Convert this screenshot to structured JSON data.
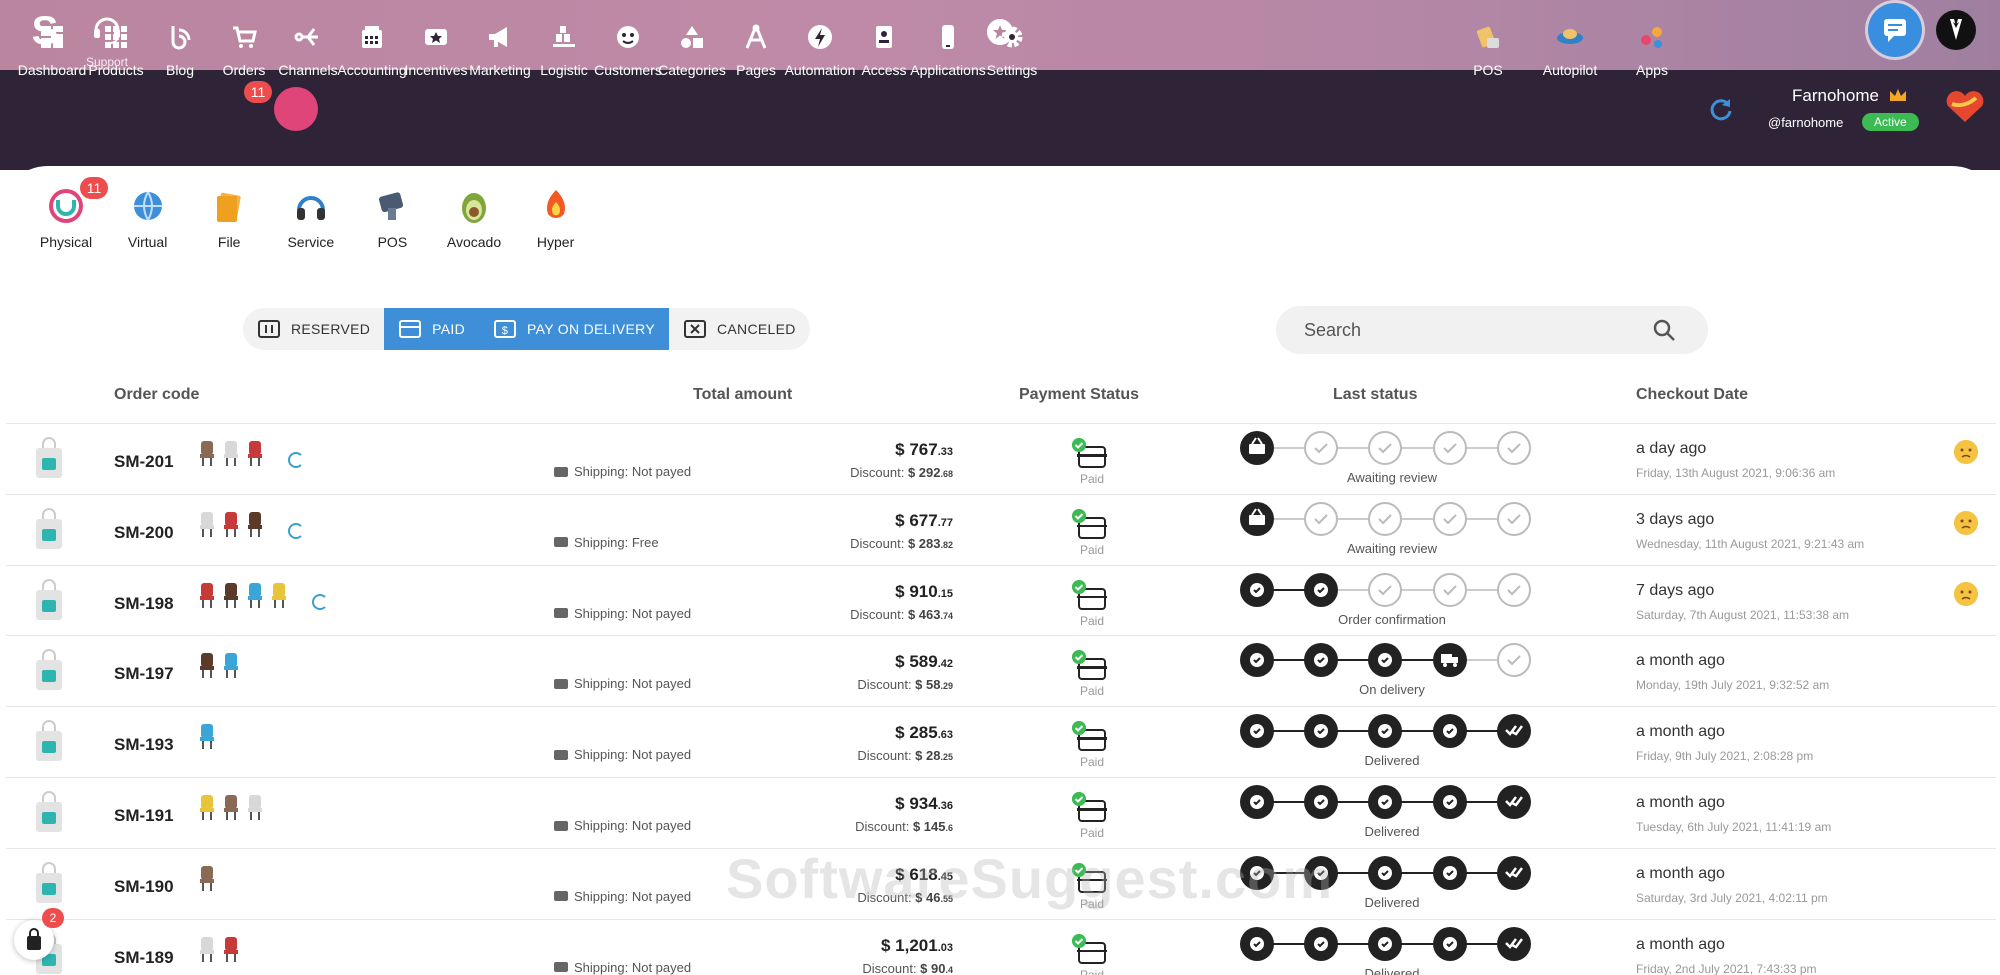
{
  "top": {
    "support_label": "Support"
  },
  "nav": {
    "items": [
      {
        "label": "Dashboard",
        "icon": "dashboard-icon"
      },
      {
        "label": "Products",
        "icon": "products-icon"
      },
      {
        "label": "Blog",
        "icon": "blog-icon"
      },
      {
        "label": "Orders",
        "icon": "cart-icon",
        "badge": "11"
      },
      {
        "label": "Channels",
        "icon": "channels-icon"
      },
      {
        "label": "Accounting",
        "icon": "accounting-icon"
      },
      {
        "label": "Incentives",
        "icon": "incentives-icon"
      },
      {
        "label": "Marketing",
        "icon": "megaphone-icon"
      },
      {
        "label": "Logistic",
        "icon": "logistic-icon"
      },
      {
        "label": "Customers",
        "icon": "customers-icon"
      },
      {
        "label": "Categories",
        "icon": "categories-icon"
      },
      {
        "label": "Pages",
        "icon": "pages-icon"
      },
      {
        "label": "Automation",
        "icon": "automation-icon"
      },
      {
        "label": "Access",
        "icon": "access-icon"
      },
      {
        "label": "Applications",
        "icon": "applications-icon"
      },
      {
        "label": "Settings",
        "icon": "gear-icon"
      }
    ],
    "right": [
      {
        "label": "POS",
        "icon": "pos-icon"
      },
      {
        "label": "Autopilot",
        "icon": "autopilot-icon"
      },
      {
        "label": "Apps",
        "icon": "apps-icon"
      }
    ],
    "profile": {
      "name": "Farnohome",
      "handle": "@farnohome",
      "status": "Active"
    }
  },
  "subtypes": [
    {
      "label": "Physical",
      "badge": "11"
    },
    {
      "label": "Virtual"
    },
    {
      "label": "File"
    },
    {
      "label": "Service"
    },
    {
      "label": "POS"
    },
    {
      "label": "Avocado"
    },
    {
      "label": "Hyper"
    }
  ],
  "filters": [
    {
      "label": "RESERVED",
      "active": false
    },
    {
      "label": "PAID",
      "active": true
    },
    {
      "label": "PAY ON DELIVERY",
      "active": true
    },
    {
      "label": "CANCELED",
      "active": false
    }
  ],
  "search": {
    "placeholder": "Search"
  },
  "table": {
    "headers": {
      "order_code": "Order code",
      "total_amount": "Total amount",
      "payment_status": "Payment Status",
      "last_status": "Last status",
      "checkout_date": "Checkout Date"
    },
    "rows": [
      {
        "code": "SM-201",
        "thumbs": 3,
        "spinner": true,
        "shipping": "Shipping: Not payed",
        "amount_int": "$ 767",
        "amount_dec": ".33",
        "discount_int": "$ 292",
        "discount_dec": ".68",
        "payment": "Paid",
        "steps_done": 1,
        "step_label": "Awaiting review",
        "relative": "a day ago",
        "absolute": "Friday, 13th August 2021, 9:06:36 am",
        "mood": true
      },
      {
        "code": "SM-200",
        "thumbs": 3,
        "spinner": true,
        "shipping": "Shipping: Free",
        "amount_int": "$ 677",
        "amount_dec": ".77",
        "discount_int": "$ 283",
        "discount_dec": ".82",
        "payment": "Paid",
        "steps_done": 1,
        "step_label": "Awaiting review",
        "relative": "3 days ago",
        "absolute": "Wednesday, 11th August 2021, 9:21:43 am",
        "mood": true
      },
      {
        "code": "SM-198",
        "thumbs": 4,
        "spinner": true,
        "shipping": "Shipping: Not payed",
        "amount_int": "$ 910",
        "amount_dec": ".15",
        "discount_int": "$ 463",
        "discount_dec": ".74",
        "payment": "Paid",
        "steps_done": 2,
        "step_label": "Order confirmation",
        "relative": "7 days ago",
        "absolute": "Saturday, 7th August 2021, 11:53:38 am",
        "mood": true
      },
      {
        "code": "SM-197",
        "thumbs": 2,
        "spinner": false,
        "shipping": "Shipping: Not payed",
        "amount_int": "$ 589",
        "amount_dec": ".42",
        "discount_int": "$ 58",
        "discount_dec": ".29",
        "payment": "Paid",
        "steps_done": 4,
        "step_label": "On delivery",
        "relative": "a month ago",
        "absolute": "Monday, 19th July 2021, 9:32:52 am",
        "mood": false
      },
      {
        "code": "SM-193",
        "thumbs": 1,
        "spinner": false,
        "shipping": "Shipping: Not payed",
        "amount_int": "$ 285",
        "amount_dec": ".63",
        "discount_int": "$ 28",
        "discount_dec": ".25",
        "payment": "Paid",
        "steps_done": 5,
        "step_label": "Delivered",
        "relative": "a month ago",
        "absolute": "Friday, 9th July 2021, 2:08:28 pm",
        "mood": false
      },
      {
        "code": "SM-191",
        "thumbs": 3,
        "spinner": false,
        "shipping": "Shipping: Not payed",
        "amount_int": "$ 934",
        "amount_dec": ".36",
        "discount_int": "$ 145",
        "discount_dec": ".6",
        "payment": "Paid",
        "steps_done": 5,
        "step_label": "Delivered",
        "relative": "a month ago",
        "absolute": "Tuesday, 6th July 2021, 11:41:19 am",
        "mood": false
      },
      {
        "code": "SM-190",
        "thumbs": 1,
        "spinner": false,
        "shipping": "Shipping: Not payed",
        "amount_int": "$ 618",
        "amount_dec": ".45",
        "discount_int": "$ 46",
        "discount_dec": ".55",
        "payment": "Paid",
        "steps_done": 5,
        "step_label": "Delivered",
        "relative": "a month ago",
        "absolute": "Saturday, 3rd July 2021, 4:02:11 pm",
        "mood": false
      },
      {
        "code": "SM-189",
        "thumbs": 2,
        "spinner": false,
        "shipping": "Shipping: Not payed",
        "amount_int": "$ 1,201",
        "amount_dec": ".03",
        "discount_int": "$ 90",
        "discount_dec": ".4",
        "payment": "Paid",
        "steps_done": 5,
        "step_label": "Delivered",
        "relative": "a month ago",
        "absolute": "Friday, 2nd July 2021, 7:43:33 pm",
        "mood": false
      }
    ]
  },
  "cart_badge": "2",
  "watermark": "SoftwareSuggest.com",
  "colors": {
    "nav_bg": "#2f2437",
    "accent_blue": "#3e8fd8",
    "badge_red": "#ee4d4d",
    "paid_green": "#3cba54"
  }
}
